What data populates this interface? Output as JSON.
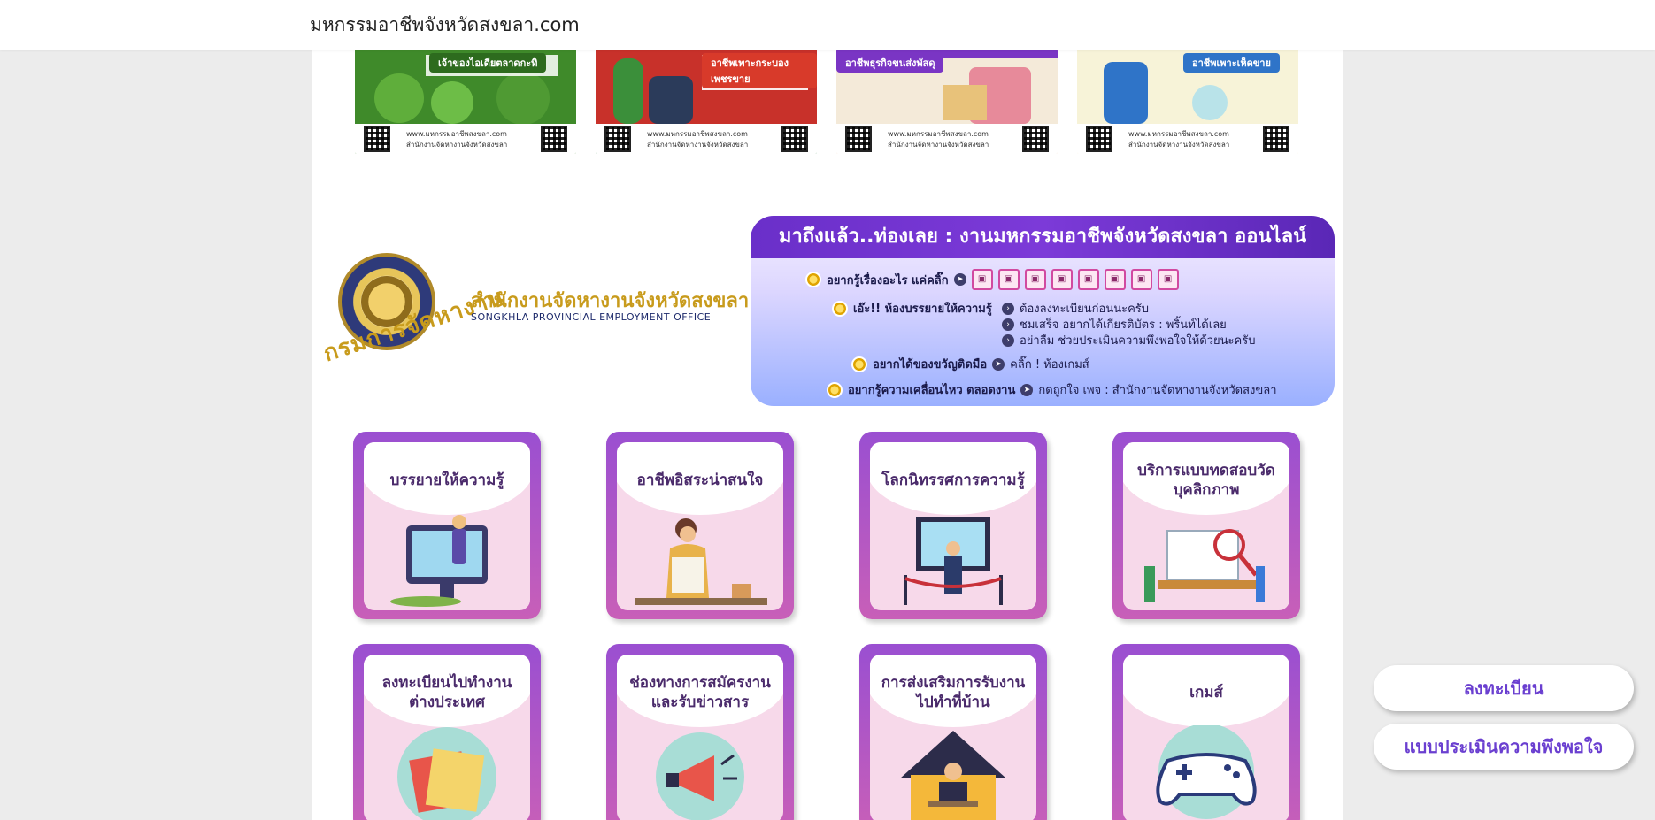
{
  "site": {
    "title": "มหกรรมอาชีพจังหวัดสงขลา.com"
  },
  "posters": [
    {
      "ribbon": "เจ้าของไอเดียตลาดกะทิ",
      "bg": "#3f8a2a",
      "ribbon_bg": "#2d6b1e",
      "links": [
        "www.มหกรรมอาชีพสงขลา.com",
        "สำนักงานจัดหางานจังหวัดสงขลา"
      ]
    },
    {
      "ribbon": "อาชีพเพาะกระบองเพชรขาย",
      "bg": "#2f7d3a",
      "ribbon_bg": "#d83a2a",
      "links": [
        "www.มหกรรมอาชีพสงขลา.com",
        "สำนักงานจัดหางานจังหวัดสงขลา"
      ]
    },
    {
      "ribbon": "อาชีพธุรกิจขนส่งพัสดุ",
      "bg": "#f2c7a8",
      "ribbon_bg": "#7a35c4",
      "links": [
        "www.มหกรรมอาชีพสงขลา.com",
        "สำนักงานจัดหางานจังหวัดสงขลา"
      ]
    },
    {
      "ribbon": "อาชีพเพาะเห็ดขาย",
      "bg": "#f7f0c8",
      "ribbon_bg": "#2f74c8",
      "links": [
        "www.มหกรรมอาชีพสงขลา.com",
        "สำนักงานจัดหางานจังหวัดสงขลา"
      ]
    }
  ],
  "office": {
    "name_th": "สำนักงานจัดหางานจังหวัดสงขลา",
    "name_en": "SONGKHLA PROVINCIAL EMPLOYMENT OFFICE",
    "dept": "กรมการจัดหางาน"
  },
  "banner": {
    "heading": "มาถึงแล้ว..ท่องเลย : งานมหกรรมอาชีพจังหวัดสงขลา ออนไลน์",
    "row1": "อยากรู้เรื่องอะไร แค่คลิ๊ก",
    "row2_label": "เอ๊ะ!! ห้องบรรยายให้ความรู้",
    "row2_items": [
      "ต้องลงทะเบียนก่อนนะครับ",
      "ชมเสร็จ อยากได้เกียรติบัตร : พริ้นท์ได้เลย",
      "อย่าลืม ช่วยประเมินความพึงพอใจให้ด้วยนะครับ"
    ],
    "row3_label": "อยากได้ของขวัญติดมือ",
    "row3_value": "คลิ๊ก ! ห้องเกมส์",
    "row4_label": "อยากรู้ความเคลื่อนไหว ตลอดงาน",
    "row4_value": "กดถูกใจ เพจ : สำนักงานจัดหางานจังหวัดสงขลา"
  },
  "cards": [
    {
      "title": "บรรยายให้ความรู้",
      "icon": "lecture-icon"
    },
    {
      "title": "อาชีพอิสระน่าสนใจ",
      "icon": "cooking-icon"
    },
    {
      "title": "โลกนิทรรศการความรู้",
      "icon": "exhibition-icon"
    },
    {
      "title": "บริการแบบทดสอบวัดบุคลิกภาพ",
      "icon": "test-icon"
    },
    {
      "title": "ลงทะเบียนไปทำงานต่างประเทศ",
      "icon": "documents-icon"
    },
    {
      "title": "ช่องทางการสมัครงานและรับข่าวสาร",
      "icon": "megaphone-icon"
    },
    {
      "title": "การส่งเสริมการรับงานไปทำที่บ้าน",
      "icon": "house-icon"
    },
    {
      "title": "เกมส์",
      "icon": "gamepad-icon"
    }
  ],
  "buttons": {
    "register": "ลงทะเบียน",
    "survey": "แบบประเมินความพึงพอใจ"
  }
}
